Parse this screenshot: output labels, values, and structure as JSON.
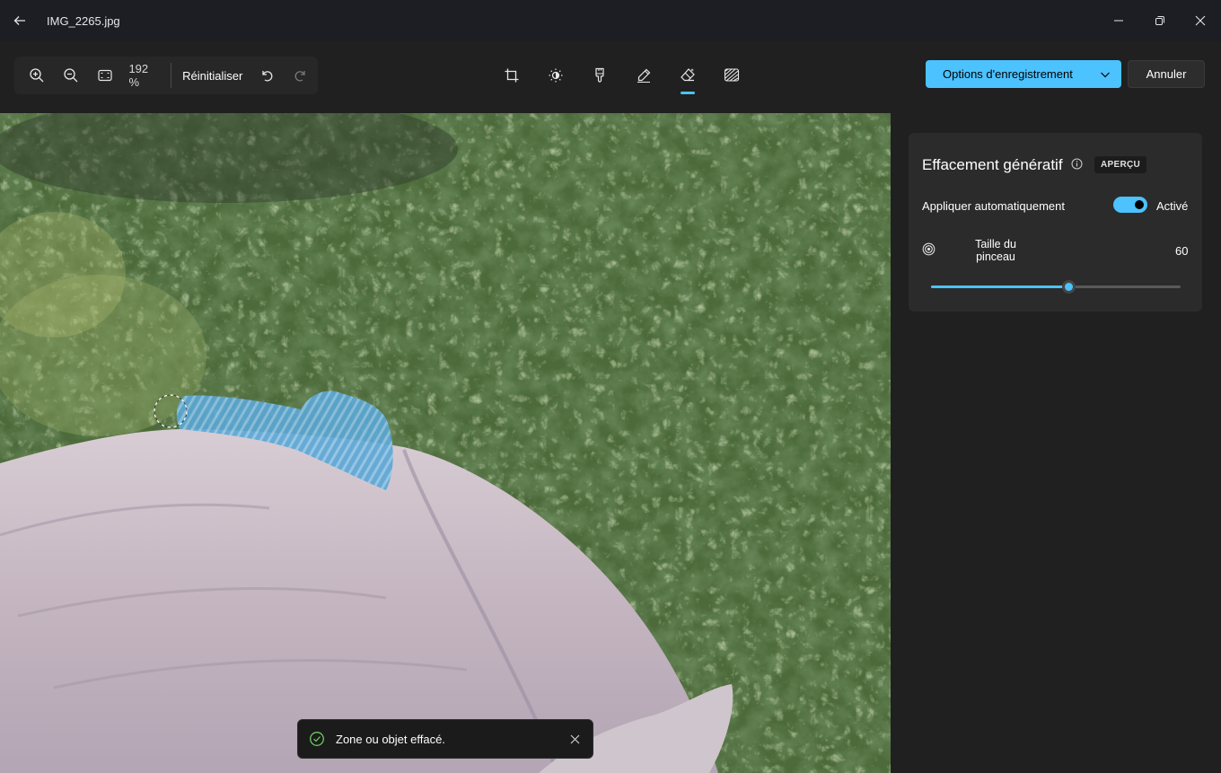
{
  "window": {
    "title": "IMG_2265.jpg",
    "back_icon": "arrow-left-icon",
    "controls": [
      "minimize-icon",
      "restore-icon",
      "close-icon"
    ]
  },
  "toolbar": {
    "zoom_level": "192 %",
    "reset_label": "Réinitialiser",
    "zoom_icons": [
      "zoom-in-icon",
      "zoom-out-icon",
      "fit-to-window-icon"
    ],
    "history_icons": [
      "undo-icon",
      "redo-icon"
    ],
    "tools": [
      {
        "name": "crop",
        "icon": "crop-icon",
        "active": false
      },
      {
        "name": "adjust",
        "icon": "brightness-icon",
        "active": false
      },
      {
        "name": "filter",
        "icon": "filter-icon",
        "active": false
      },
      {
        "name": "markup",
        "icon": "pen-icon",
        "active": false
      },
      {
        "name": "erase",
        "icon": "eraser-icon",
        "active": true
      },
      {
        "name": "background",
        "icon": "background-icon",
        "active": false
      }
    ],
    "save_label": "Options d'enregistrement",
    "cancel_label": "Annuler",
    "accent": "#4cc2ff"
  },
  "panel": {
    "title": "Effacement génératif",
    "badge": "APERÇU",
    "auto_apply_label": "Appliquer automatiquement",
    "auto_apply_state": "Activé",
    "auto_apply_on": true,
    "brush_label": "Taille du pinceau",
    "brush_value": "60",
    "brush_fraction": 0.55
  },
  "toast": {
    "message": "Zone ou objet effacé.",
    "icon": "check-circle-icon"
  }
}
